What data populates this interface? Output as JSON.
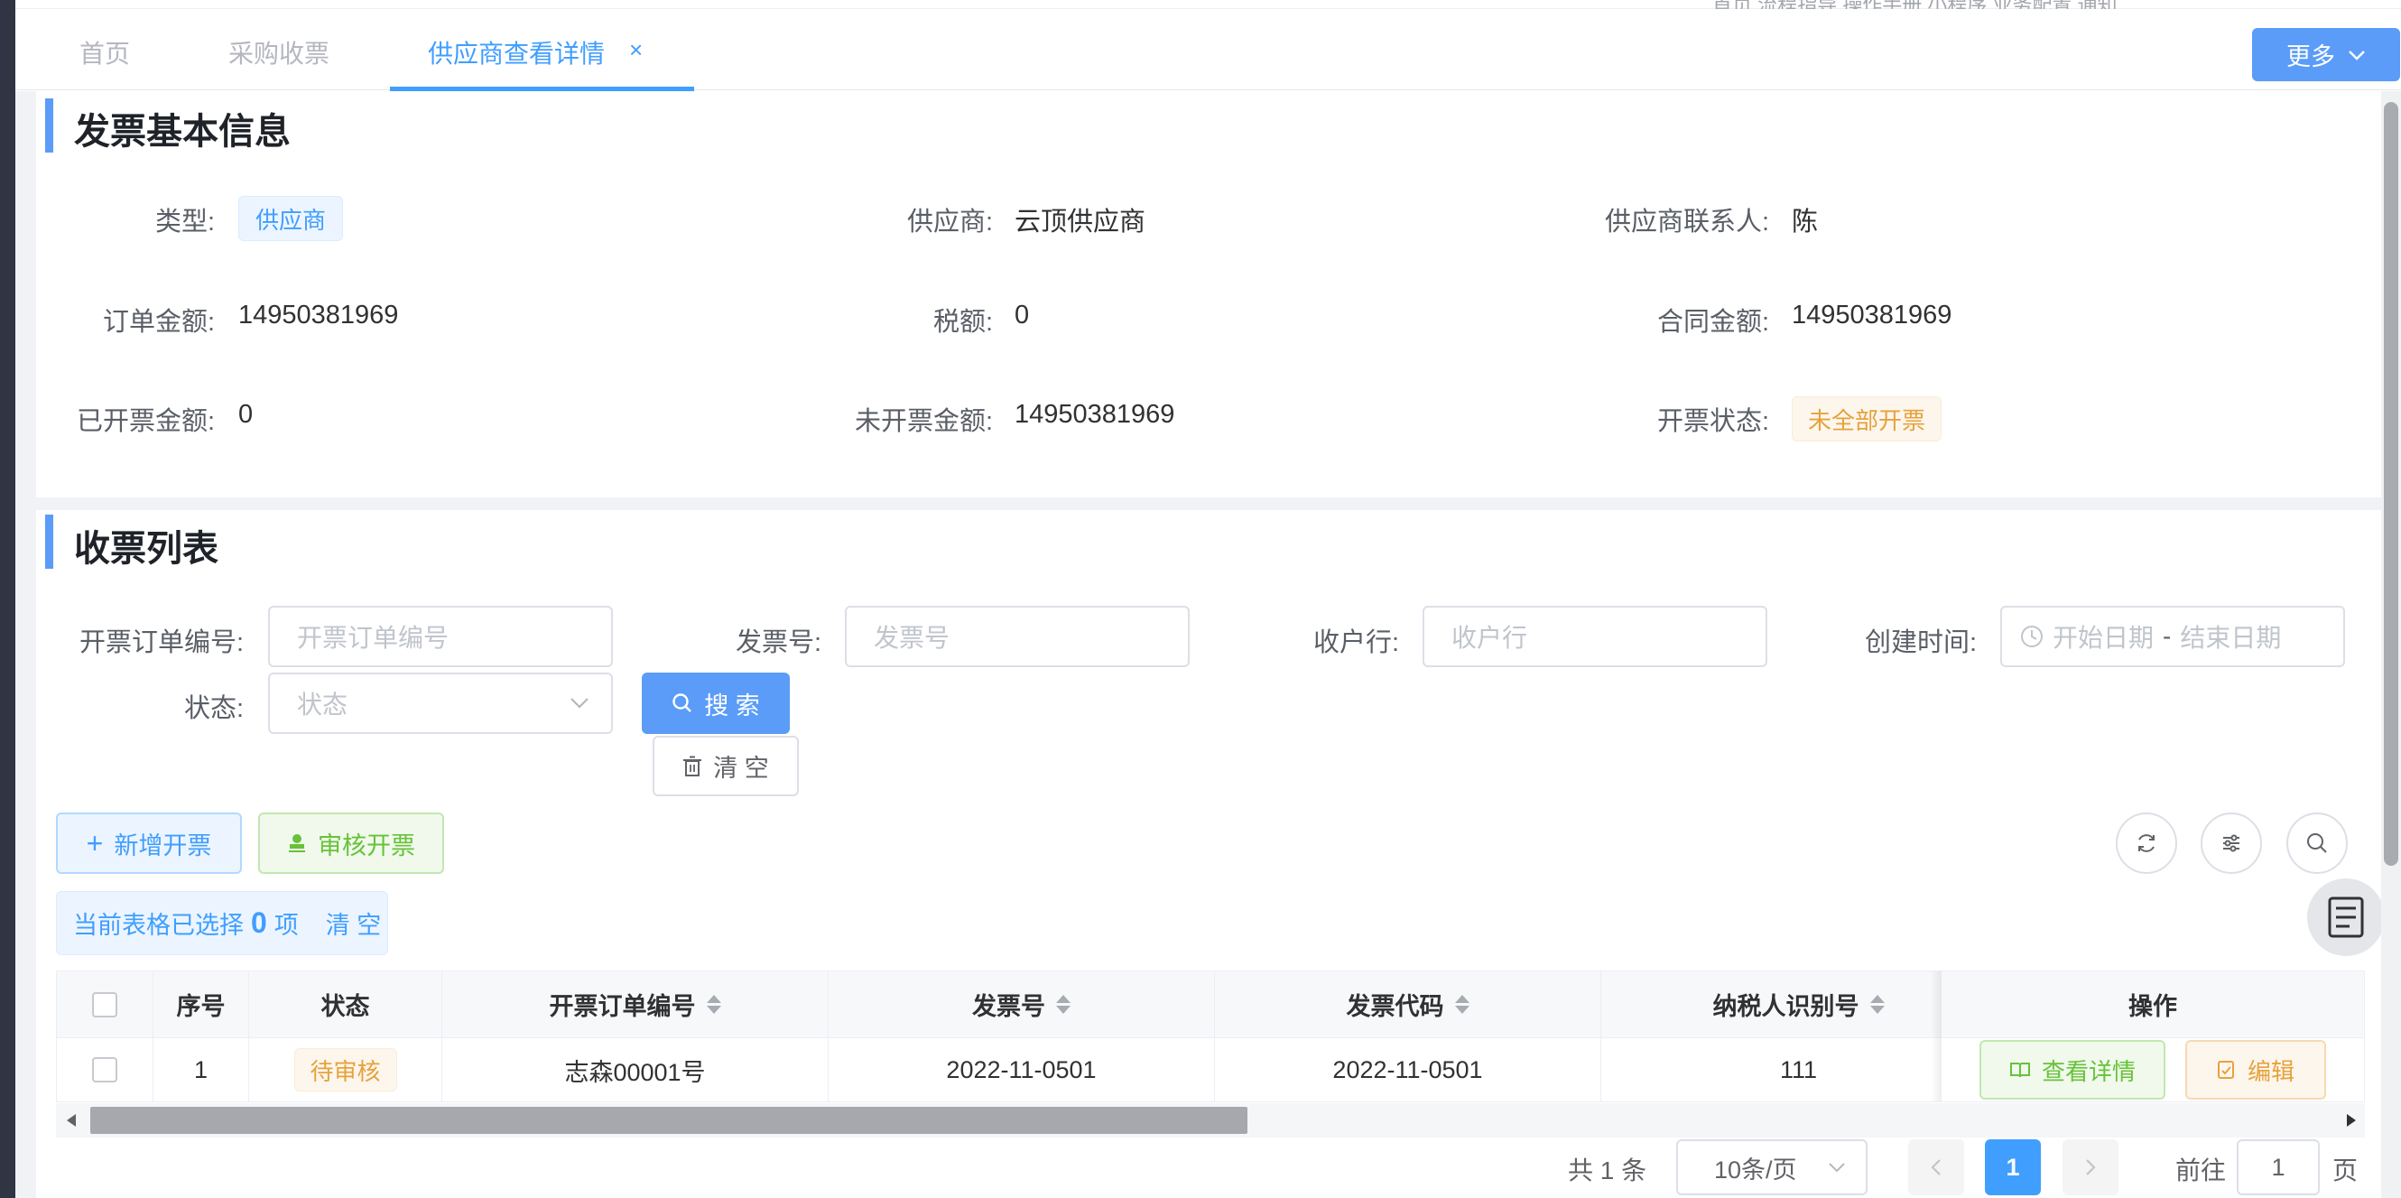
{
  "tabs": [
    {
      "label": "首页"
    },
    {
      "label": "采购收票"
    },
    {
      "label": "供应商查看详情"
    }
  ],
  "top_menu_faint": "首页  流程指导  操作手册  小程序  业务配置  通知",
  "more_button": "更多",
  "invoice_info": {
    "title": "发票基本信息",
    "fields": [
      {
        "label": "类型:",
        "value": "供应商",
        "style": "tag-blue"
      },
      {
        "label": "供应商:",
        "value": "云顶供应商"
      },
      {
        "label": "供应商联系人:",
        "value": "陈"
      },
      {
        "label": "订单金额:",
        "value": "14950381969"
      },
      {
        "label": "税额:",
        "value": "0"
      },
      {
        "label": "合同金额:",
        "value": "14950381969"
      },
      {
        "label": "已开票金额:",
        "value": "0"
      },
      {
        "label": "未开票金额:",
        "value": "14950381969"
      },
      {
        "label": "开票状态:",
        "value": "未全部开票",
        "style": "tag-orange"
      }
    ]
  },
  "receipt_list": {
    "title": "收票列表",
    "filters": {
      "order_no": {
        "label": "开票订单编号:",
        "placeholder": "开票订单编号"
      },
      "invoice_no": {
        "label": "发票号:",
        "placeholder": "发票号"
      },
      "bank": {
        "label": "收户行:",
        "placeholder": "收户行"
      },
      "created": {
        "label": "创建时间:",
        "start": "开始日期",
        "sep": "-",
        "end": "结束日期"
      },
      "status": {
        "label": "状态:",
        "placeholder": "状态"
      }
    },
    "search_button": "搜 索",
    "clear_button": "清 空",
    "add_button": "新增开票",
    "audit_button": "审核开票",
    "selection": {
      "prefix": "当前表格已选择",
      "count": "0",
      "suffix": "项",
      "clear": "清 空"
    },
    "columns": [
      "序号",
      "状态",
      "开票订单编号",
      "发票号",
      "发票代码",
      "纳税人识别号",
      "操作"
    ],
    "rows": [
      {
        "index": "1",
        "status": "待审核",
        "order_no": "志森00001号",
        "invoice_no": "2022-11-0501",
        "invoice_code": "2022-11-0501",
        "taxpayer_id": "111",
        "view": "查看详情",
        "edit": "编辑"
      }
    ],
    "pagination": {
      "total": "共 1 条",
      "page_size": "10条/页",
      "current_page": "1",
      "goto_prefix": "前往",
      "goto_value": "1",
      "goto_suffix": "页"
    }
  },
  "colors": {
    "primary": "#409eff",
    "success": "#67c23a",
    "warning": "#e6a23c"
  }
}
